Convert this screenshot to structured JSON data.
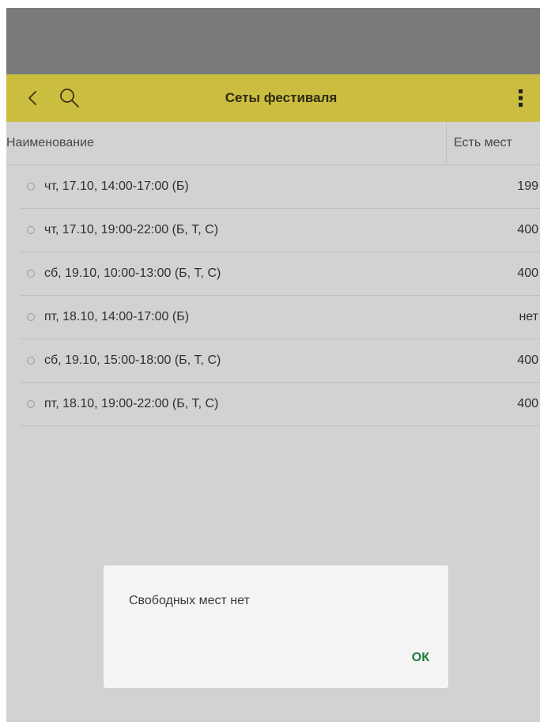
{
  "app_bar": {
    "title": "Сеты фестиваля",
    "back_icon": "chevron-left-icon",
    "search_icon": "search-icon",
    "menu_icon": "more-vert-icon",
    "color": "#cbbd3f"
  },
  "table": {
    "columns": [
      "Наименование",
      "Есть мест"
    ],
    "rows": [
      {
        "label": "чт, 17.10, 14:00-17:00 (Б)",
        "seats": "199"
      },
      {
        "label": "чт, 17.10, 19:00-22:00 (Б, Т, С)",
        "seats": "400"
      },
      {
        "label": "сб, 19.10, 10:00-13:00 (Б, Т, С)",
        "seats": "400"
      },
      {
        "label": "пт, 18.10, 14:00-17:00 (Б)",
        "seats": "нет"
      },
      {
        "label": "сб, 19.10, 15:00-18:00 (Б, Т, С)",
        "seats": "400"
      },
      {
        "label": "пт, 18.10, 19:00-22:00 (Б, Т, С)",
        "seats": "400"
      }
    ]
  },
  "dialog": {
    "message": "Свободных мест нет",
    "ok_label": "ОК",
    "ok_color": "#1e7d38"
  }
}
